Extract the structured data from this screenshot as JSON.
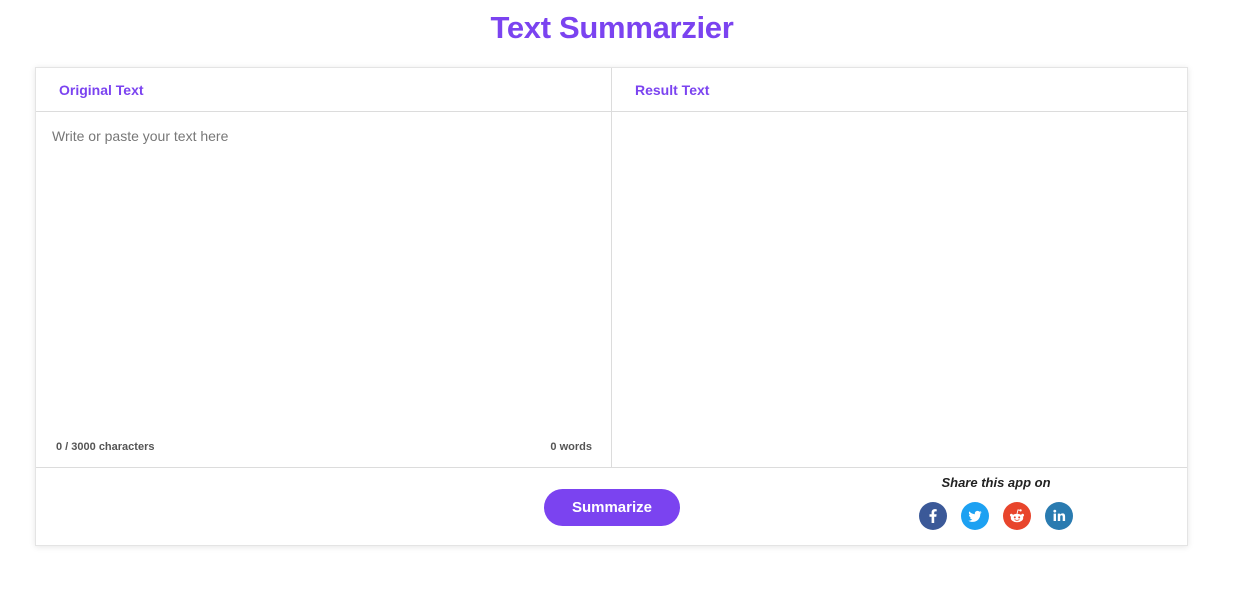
{
  "header": {
    "title": "Text Summarzier"
  },
  "input_panel": {
    "title": "Original Text",
    "placeholder": "Write or paste your text here",
    "value": "",
    "char_count": "0 / 3000 characters",
    "word_count": "0 words"
  },
  "result_panel": {
    "title": "Result Text",
    "value": ""
  },
  "footer": {
    "summarize_label": "Summarize",
    "share_label": "Share this app on",
    "share_icons": [
      {
        "name": "facebook-icon",
        "color": "#3b5998"
      },
      {
        "name": "twitter-icon",
        "color": "#1da1f2"
      },
      {
        "name": "reddit-icon",
        "color": "#ff4500"
      },
      {
        "name": "linkedin-icon",
        "color": "#2a7bb0"
      }
    ]
  },
  "colors": {
    "accent": "#7b43f0"
  }
}
